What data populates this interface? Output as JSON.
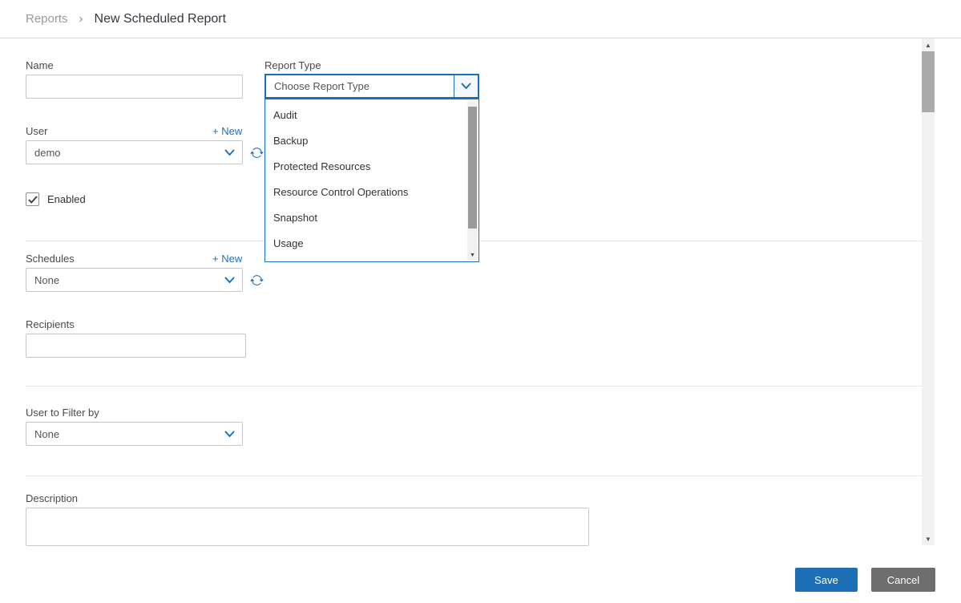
{
  "breadcrumb": {
    "parent": "Reports",
    "separator": "›",
    "current": "New Scheduled Report"
  },
  "form": {
    "name": {
      "label": "Name",
      "value": ""
    },
    "report_type": {
      "label": "Report Type",
      "selected": "Choose Report Type",
      "options": [
        "Audit",
        "Backup",
        "Protected Resources",
        "Resource Control Operations",
        "Snapshot",
        "Usage"
      ]
    },
    "user": {
      "label": "User",
      "new_link": "+ New",
      "selected": "demo"
    },
    "enabled": {
      "label": "Enabled",
      "checked": true
    },
    "schedules": {
      "label": "Schedules",
      "new_link": "+ New",
      "selected": "None"
    },
    "recipients": {
      "label": "Recipients",
      "value": ""
    },
    "user_to_filter": {
      "label": "User to Filter by",
      "selected": "None"
    },
    "description": {
      "label": "Description",
      "value": ""
    }
  },
  "footer": {
    "save_label": "Save",
    "cancel_label": "Cancel"
  },
  "icons": {
    "up_arrow": "▲",
    "down_arrow": "▼"
  },
  "colors": {
    "accent": "#2271b3",
    "save_bg": "#1d6fb5",
    "cancel_bg": "#6e6e6e"
  }
}
